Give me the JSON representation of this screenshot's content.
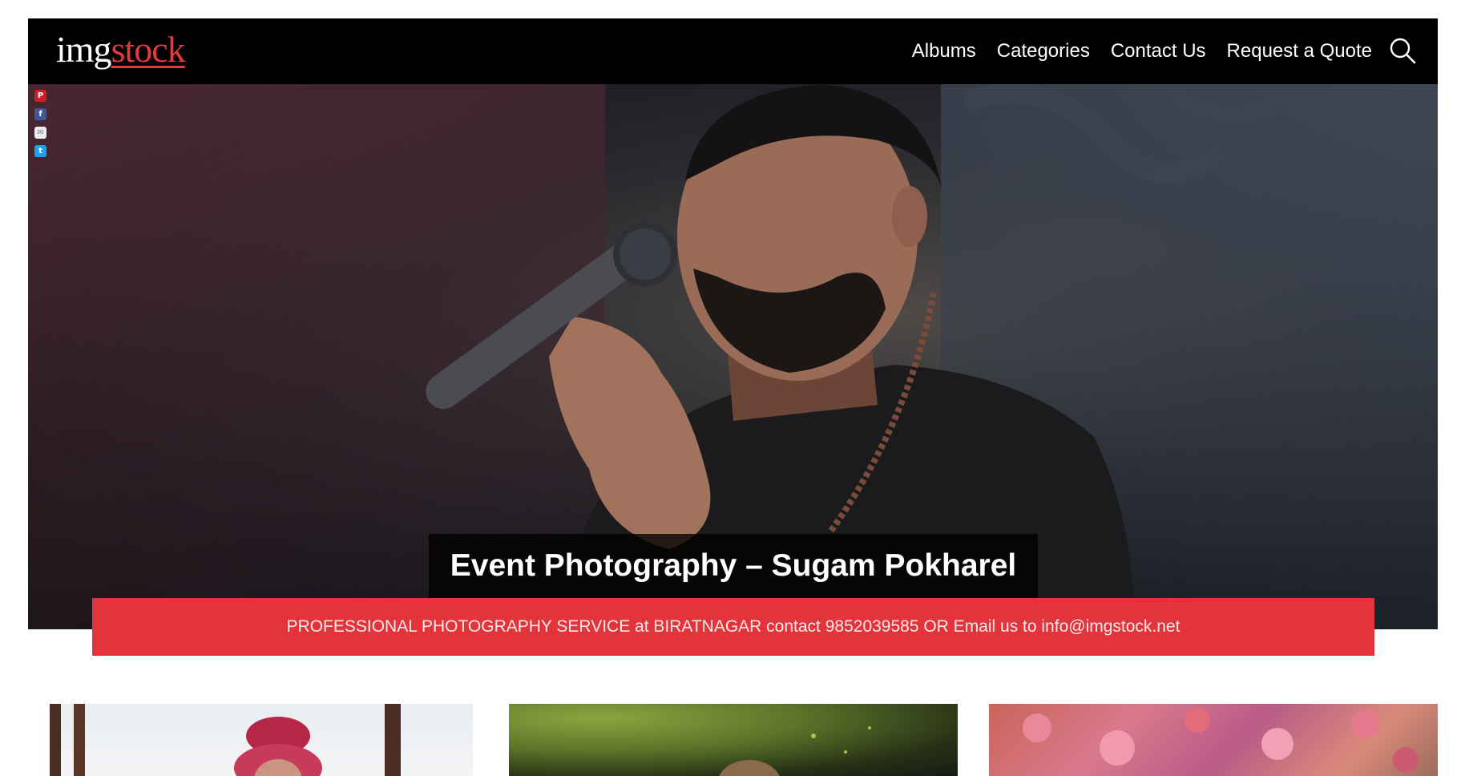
{
  "logo": {
    "part1": "img",
    "part2": "stock"
  },
  "nav": {
    "items": [
      {
        "label": "Albums"
      },
      {
        "label": "Categories"
      },
      {
        "label": "Contact Us"
      },
      {
        "label": "Request a Quote"
      }
    ],
    "search_icon": "search-icon"
  },
  "share": {
    "icons": [
      "pinterest-icon",
      "facebook-icon",
      "email-icon",
      "twitter-icon"
    ]
  },
  "hero": {
    "caption": "Event Photography – Sugam Pokharel"
  },
  "banner": {
    "text": "PROFESSIONAL PHOTOGRAPHY SERVICE at BIRATNAGAR contact 9852039585 OR Email us to info@imgstock.net"
  },
  "colors": {
    "header_bg": "#000000",
    "brand_red": "#e3343b",
    "text_white": "#ffffff"
  }
}
